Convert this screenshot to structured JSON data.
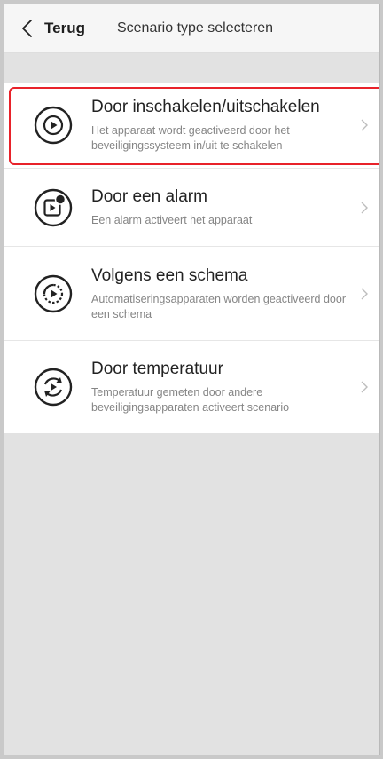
{
  "header": {
    "back_label": "Terug",
    "title": "Scenario type selecteren"
  },
  "items": [
    {
      "icon": "play-circle-icon",
      "title": "Door inschakelen/uitschakelen",
      "description": "Het apparaat wordt geactiveerd door het beveiligingssysteem in/uit te schakelen",
      "selected": true
    },
    {
      "icon": "play-alarm-icon",
      "title": "Door een alarm",
      "description": "Een alarm activeert het apparaat",
      "selected": false
    },
    {
      "icon": "schedule-play-icon",
      "title": "Volgens een schema",
      "description": "Automatiseringsapparaten worden geactiveerd door een schema",
      "selected": false
    },
    {
      "icon": "temperature-cycle-icon",
      "title": "Door temperatuur",
      "description": "Temperatuur gemeten door andere beveiligingsapparaten activeert scenario",
      "selected": false
    }
  ],
  "colors": {
    "selection_border": "#e8222a",
    "background": "#e2e2e2",
    "card": "#ffffff"
  }
}
